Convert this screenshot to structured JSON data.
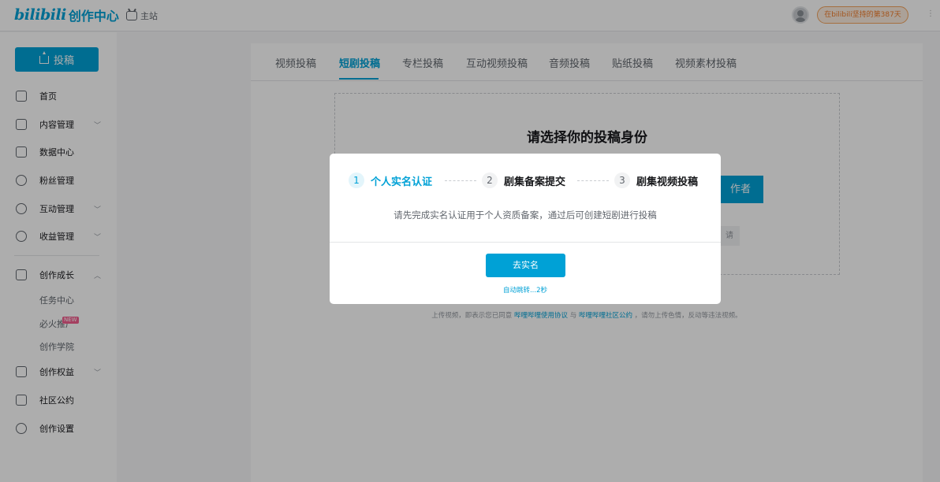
{
  "header": {
    "logo_text": "bilibili",
    "logo_suffix": "创作中心",
    "home_label": "主站",
    "days_badge": "在bilibili坚持的第387天"
  },
  "sidebar": {
    "upload_label": "投稿",
    "items": [
      {
        "label": "首页",
        "icon": "home-icon"
      },
      {
        "label": "内容管理",
        "icon": "content-icon",
        "expandable": true
      },
      {
        "label": "数据中心",
        "icon": "data-icon"
      },
      {
        "label": "粉丝管理",
        "icon": "fans-icon"
      },
      {
        "label": "互动管理",
        "icon": "interaction-icon",
        "expandable": true
      },
      {
        "label": "收益管理",
        "icon": "income-icon",
        "expandable": true
      },
      {
        "label": "创作成长",
        "icon": "growth-icon",
        "expanded": true
      },
      {
        "label": "创作权益",
        "icon": "rights-icon",
        "expandable": true
      },
      {
        "label": "社区公约",
        "icon": "community-icon"
      },
      {
        "label": "创作设置",
        "icon": "settings-icon"
      }
    ],
    "growth_sub": [
      "任务中心",
      "必火推广",
      "创作学院"
    ],
    "new_badge": "NEW"
  },
  "tabs": [
    "视频投稿",
    "短剧投稿",
    "专栏投稿",
    "互动视频投稿",
    "音频投稿",
    "贴纸投稿",
    "视频素材投稿"
  ],
  "active_tab": 1,
  "main": {
    "identity_title": "请选择你的投稿身份",
    "creator_btn_visible": "作者",
    "small_chip_visible": "请",
    "agreement_pre": "上传视频，即表示您已同意",
    "agreement_link1": "哔哩哔哩使用协议",
    "agreement_and": "与",
    "agreement_link2": "哔哩哔哩社区公约",
    "agreement_post": "，请勿上传色情，反动等违法视频。"
  },
  "modal": {
    "steps": [
      {
        "num": "1",
        "label": "个人实名认证"
      },
      {
        "num": "2",
        "label": "剧集备案提交"
      },
      {
        "num": "3",
        "label": "剧集视频投稿"
      }
    ],
    "active_step": 0,
    "desc": "请先完成实名认证用于个人资质备案，通过后可创建短剧进行投稿",
    "button": "去实名",
    "auto_jump": "自动跳转...2秒"
  },
  "colors": {
    "brand": "#00a1d6",
    "badge_orange": "#f07c2a",
    "new_pink": "#f25d8e"
  }
}
